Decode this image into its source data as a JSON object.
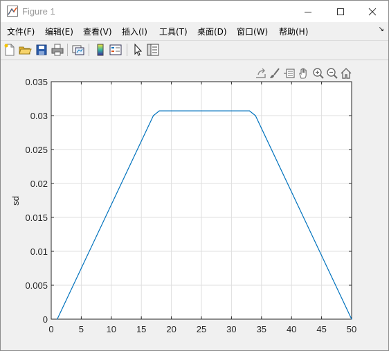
{
  "window": {
    "title": "Figure 1"
  },
  "menu": {
    "items": [
      "文件(F)",
      "编辑(E)",
      "查看(V)",
      "插入(I)",
      "工具(T)",
      "桌面(D)",
      "窗口(W)",
      "帮助(H)"
    ]
  },
  "toolbar": {
    "icons": [
      "new-figure-icon",
      "open-icon",
      "save-icon",
      "print-icon",
      "link-plot-icon",
      "colorbar-icon",
      "legend-icon",
      "pointer-icon",
      "property-editor-icon"
    ]
  },
  "axes_toolbar": {
    "icons": [
      "export-icon",
      "brush-icon",
      "data-tips-icon",
      "pan-icon",
      "zoom-in-icon",
      "zoom-out-icon",
      "home-icon"
    ]
  },
  "chart_data": {
    "type": "line",
    "title": "",
    "xlabel": "",
    "ylabel": "sd",
    "xlim": [
      0,
      50
    ],
    "ylim": [
      0,
      0.035
    ],
    "x_ticks": [
      "0",
      "5",
      "10",
      "15",
      "20",
      "25",
      "30",
      "35",
      "40",
      "45",
      "50"
    ],
    "y_ticks": [
      "0",
      "0.005",
      "0.01",
      "0.015",
      "0.02",
      "0.025",
      "0.03",
      "0.035"
    ],
    "grid": true,
    "line_color": "#0072bd",
    "series": [
      {
        "x": [
          1,
          17,
          18,
          33,
          34,
          50
        ],
        "y": [
          0,
          0.03,
          0.0307,
          0.0307,
          0.03,
          0
        ]
      }
    ]
  }
}
